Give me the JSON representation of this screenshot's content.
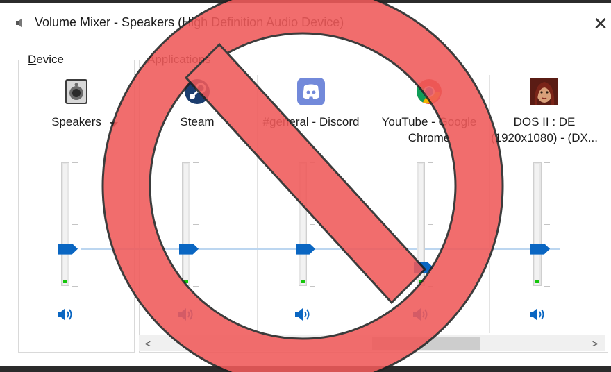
{
  "window": {
    "title": "Volume Mixer - Speakers (High Definition Audio Device)",
    "close_glyph": "✕"
  },
  "groups": {
    "device_label": "Device",
    "applications_label": "Applications"
  },
  "channels": [
    {
      "name_line1": "Speakers",
      "name_line2": "",
      "icon": "speaker-device-icon",
      "level_fraction": 0.3,
      "has_dropdown": true
    },
    {
      "name_line1": "Steam",
      "name_line2": "",
      "icon": "steam-icon",
      "level_fraction": 0.3,
      "has_dropdown": false
    },
    {
      "name_line1": "#general - Discord",
      "name_line2": "",
      "icon": "discord-icon",
      "level_fraction": 0.3,
      "has_dropdown": false
    },
    {
      "name_line1": "YouTube - Google",
      "name_line2": "Chrome",
      "icon": "chrome-icon",
      "level_fraction": 0.15,
      "has_dropdown": false
    },
    {
      "name_line1": "DOS II : DE",
      "name_line2": "(1920x1080) - (DX...",
      "icon": "game-portrait-icon",
      "level_fraction": 0.3,
      "has_dropdown": false
    }
  ],
  "scrollbar": {
    "left_arrow": "<",
    "right_arrow": ">"
  },
  "colors": {
    "accent": "#0a66c2",
    "meter_green": "#16c60c",
    "prohibition_red": "#f05a5a"
  }
}
